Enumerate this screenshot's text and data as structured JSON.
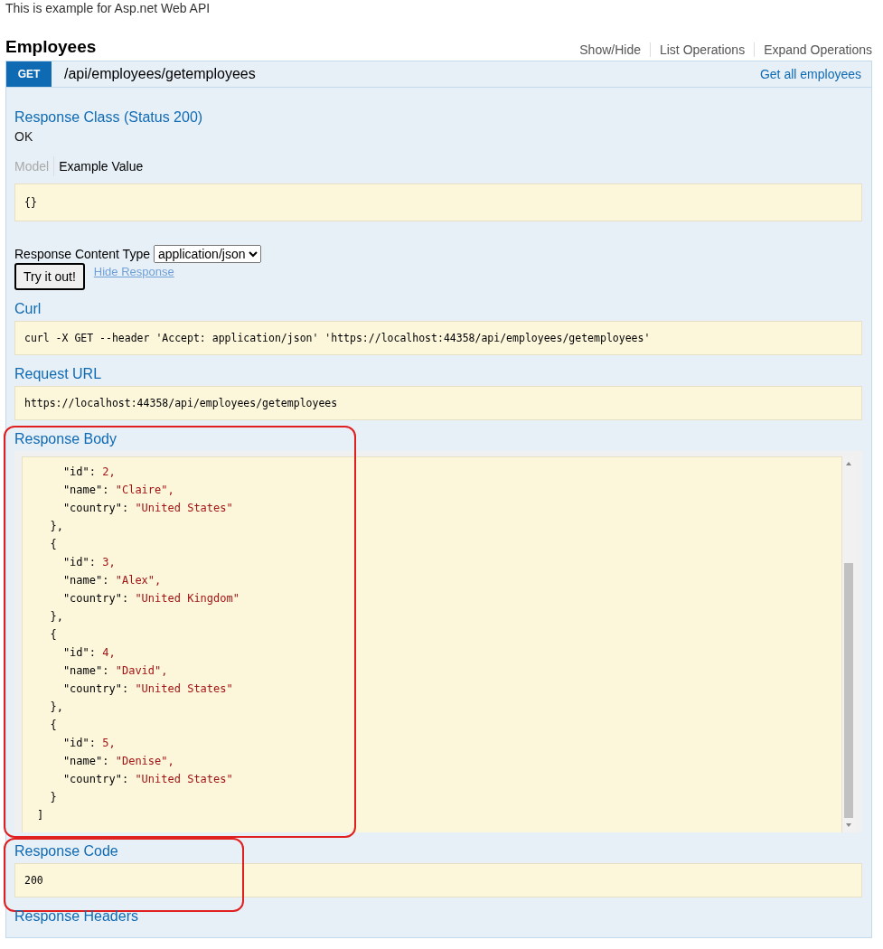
{
  "intro": "This is example for Asp.net Web API",
  "resource": {
    "name": "Employees",
    "links": [
      "Show/Hide",
      "List Operations",
      "Expand Operations"
    ]
  },
  "operation": {
    "method": "GET",
    "path": "/api/employees/getemployees",
    "summary": "Get all employees",
    "response_class": {
      "title": "Response Class (Status 200)",
      "status": "OK",
      "tabs": [
        {
          "label": "Model",
          "selected": false
        },
        {
          "label": "Example Value",
          "selected": true
        }
      ],
      "example": "{}"
    },
    "content_type": {
      "label": "Response Content Type",
      "value": "application/json"
    },
    "try_button": "Try it out!",
    "hide_link": "Hide Response",
    "results": [
      {
        "title": "Curl",
        "kind": "code",
        "highlighted": false,
        "lines": [
          "curl -X GET --header 'Accept: application/json' 'https://localhost:44358/api/employees/getemployees'"
        ]
      },
      {
        "title": "Request URL",
        "kind": "code",
        "highlighted": false,
        "lines": [
          "https://localhost:44358/api/employees/getemployees"
        ]
      },
      {
        "title": "Response Body",
        "kind": "scroll",
        "highlighted": true,
        "lines": [
          "    \"id\": 2,",
          "    \"name\": \"Claire\",",
          "    \"country\": \"United States\"",
          "  },",
          "  {",
          "    \"id\": 3,",
          "    \"name\": \"Alex\",",
          "    \"country\": \"United Kingdom\"",
          "  },",
          "  {",
          "    \"id\": 4,",
          "    \"name\": \"David\",",
          "    \"country\": \"United States\"",
          "  },",
          "  {",
          "    \"id\": 5,",
          "    \"name\": \"Denise\",",
          "    \"country\": \"United States\"",
          "  }",
          "]"
        ]
      },
      {
        "title": "Response Code",
        "kind": "code",
        "highlighted": true,
        "lines": [
          "200"
        ]
      },
      {
        "title": "Response Headers",
        "kind": "heading",
        "highlighted": false
      }
    ]
  }
}
